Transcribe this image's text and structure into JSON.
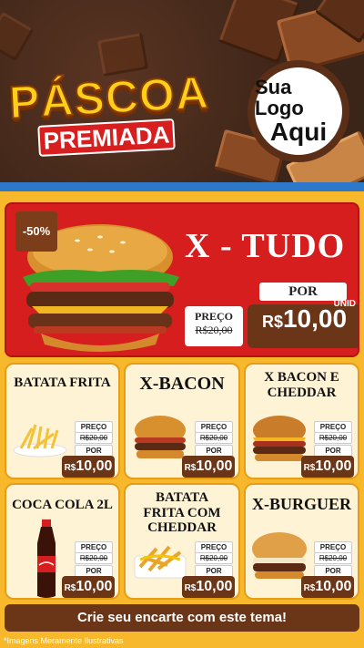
{
  "header": {
    "title_line1": "PÁSCOA",
    "title_line2": "PREMIADA",
    "logo_line1": "Sua Logo",
    "logo_line2": "Aqui"
  },
  "hero": {
    "discount": "-50%",
    "title": "X - TUDO",
    "price_label": "PREÇO",
    "old_price": "R$20,00",
    "por_label": "POR",
    "currency": "R$",
    "new_price": "10,00",
    "unit": "UNID"
  },
  "cards": [
    {
      "title": "BATATA FRITA",
      "price_label": "PREÇO",
      "old_price": "R$20,00",
      "por_label": "POR",
      "currency": "R$",
      "price": "10,00"
    },
    {
      "title": "X-BACON",
      "price_label": "PREÇO",
      "old_price": "R$20,00",
      "por_label": "POR",
      "currency": "R$",
      "price": "10,00"
    },
    {
      "title": "X BACON E CHEDDAR",
      "price_label": "PREÇO",
      "old_price": "R$20,00",
      "por_label": "POR",
      "currency": "R$",
      "price": "10,00"
    },
    {
      "title": "COCA COLA 2L",
      "price_label": "PREÇO",
      "old_price": "R$20,00",
      "por_label": "POR",
      "currency": "R$",
      "price": "10,00"
    },
    {
      "title": "BATATA FRITA COM CHEDDAR",
      "price_label": "PREÇO",
      "old_price": "R$20,00",
      "por_label": "POR",
      "currency": "R$",
      "price": "10,00"
    },
    {
      "title": "X-BURGUER",
      "price_label": "PREÇO",
      "old_price": "R$20,00",
      "por_label": "POR",
      "currency": "R$",
      "price": "10,00"
    }
  ],
  "footer": {
    "cta": "Crie seu encarte com este tema!",
    "disclaimer": "*Imagens Meramente Ilustrativas"
  },
  "colors": {
    "red": "#d61e1e",
    "yellow": "#f7b92b",
    "chocolate": "#6b3618",
    "blue_stripe": "#2d78c8"
  }
}
